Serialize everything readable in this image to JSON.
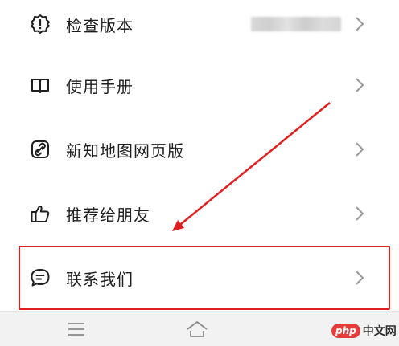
{
  "menu": {
    "items": [
      {
        "label": "检查版本",
        "icon": "alert-badge-icon"
      },
      {
        "label": "使用手册",
        "icon": "book-icon"
      },
      {
        "label": "新知地图网页版",
        "icon": "link-icon"
      },
      {
        "label": "推荐给朋友",
        "icon": "thumbs-up-icon"
      },
      {
        "label": "联系我们",
        "icon": "chat-bubble-icon"
      }
    ]
  },
  "colors": {
    "annotation": "#e02020",
    "icon": "#1f1f1f",
    "chevron": "#9a9a9a"
  },
  "bottom_nav": {
    "icons": [
      "menu-icon",
      "home-icon"
    ]
  },
  "watermark": {
    "badge": "php",
    "text": "中文网"
  }
}
